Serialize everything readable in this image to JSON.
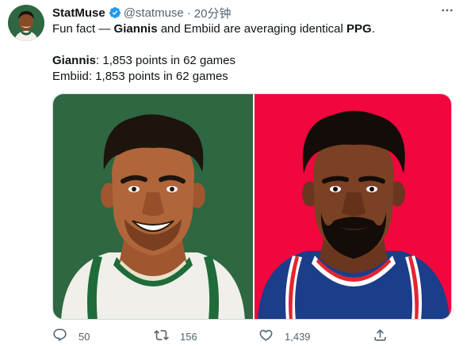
{
  "tweet": {
    "author_name": "StatMuse",
    "handle": "@statmuse",
    "separator": "·",
    "time": "20分钟",
    "more_label": "···",
    "text": {
      "line1_prefix": "Fun fact — ",
      "line1_bold1": "Giannis",
      "line1_mid": " and Embiid are averaging identical ",
      "line1_bold2": "PPG",
      "line1_suffix": ".",
      "line2_bold": "Giannis",
      "line2_rest": ": 1,853 points in 62 games",
      "line3": "Embiid: 1,853 points in 62 games"
    }
  },
  "media": {
    "left_bg": "#2e6741",
    "right_bg": "#f2063e",
    "left_icon": "giannis-illustration",
    "right_icon": "embiid-illustration"
  },
  "actions": {
    "reply_count": "50",
    "retweet_count": "156",
    "like_count": "1,439"
  },
  "colors": {
    "verified": "#1d9bf0",
    "muted": "#536471",
    "text": "#0f1419"
  }
}
